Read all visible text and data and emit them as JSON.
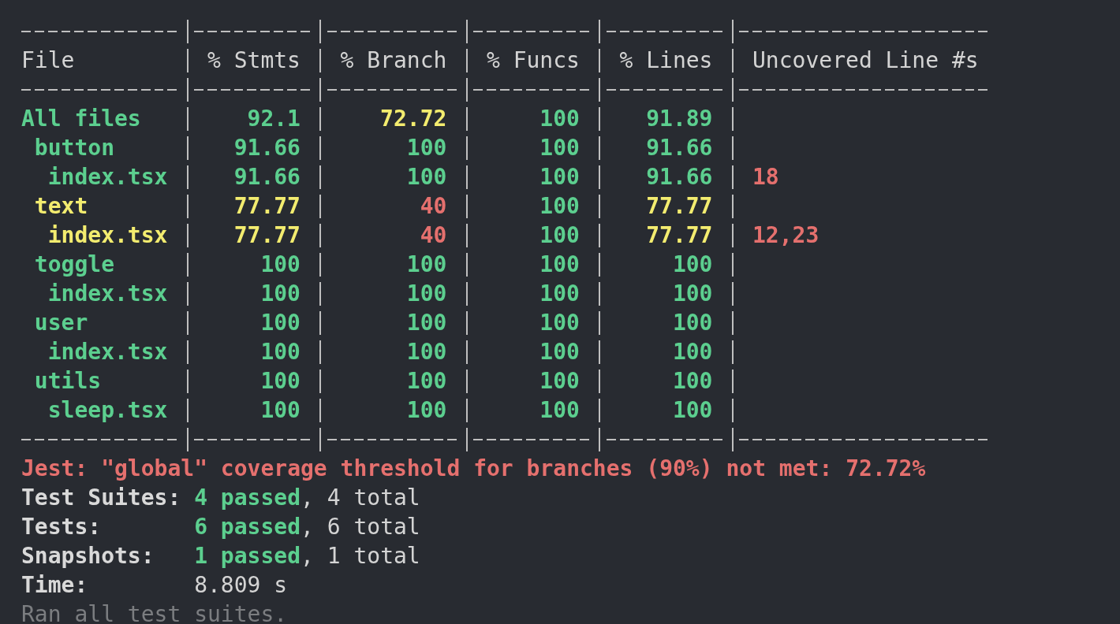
{
  "table": {
    "columns": [
      {
        "kind": "file",
        "label": "File"
      },
      {
        "kind": "stmts",
        "label": "% Stmts"
      },
      {
        "kind": "branch",
        "label": "% Branch"
      },
      {
        "kind": "funcs",
        "label": "% Funcs"
      },
      {
        "kind": "lines",
        "label": "% Lines"
      },
      {
        "kind": "uncovered",
        "label": "Uncovered Line #s"
      }
    ],
    "rows": [
      {
        "file": "All files",
        "color": "#5ccf8f",
        "stmts": {
          "text": "92.1",
          "color": "#5ccf8f"
        },
        "branch": {
          "text": "72.72",
          "color": "#f3ec6f"
        },
        "funcs": {
          "text": "100",
          "color": "#5ccf8f"
        },
        "lines": {
          "text": "91.89",
          "color": "#5ccf8f"
        },
        "children": [
          {
            "file": "button",
            "color": "#5ccf8f",
            "stmts": {
              "text": "91.66",
              "color": "#5ccf8f"
            },
            "branch": {
              "text": "100",
              "color": "#5ccf8f"
            },
            "funcs": {
              "text": "100",
              "color": "#5ccf8f"
            },
            "lines": {
              "text": "91.66",
              "color": "#5ccf8f"
            },
            "children": [
              {
                "file": "index.tsx",
                "color": "#5ccf8f",
                "stmts": {
                  "text": "91.66",
                  "color": "#5ccf8f"
                },
                "branch": {
                  "text": "100",
                  "color": "#5ccf8f"
                },
                "funcs": {
                  "text": "100",
                  "color": "#5ccf8f"
                },
                "lines": {
                  "text": "91.66",
                  "color": "#5ccf8f"
                },
                "uncovered": "18"
              }
            ]
          },
          {
            "file": "text",
            "color": "#f3ec6f",
            "stmts": {
              "text": "77.77",
              "color": "#f3ec6f"
            },
            "branch": {
              "text": "40",
              "color": "#e5706e"
            },
            "funcs": {
              "text": "100",
              "color": "#5ccf8f"
            },
            "lines": {
              "text": "77.77",
              "color": "#f3ec6f"
            },
            "children": [
              {
                "file": "index.tsx",
                "color": "#f3ec6f",
                "stmts": {
                  "text": "77.77",
                  "color": "#f3ec6f"
                },
                "branch": {
                  "text": "40",
                  "color": "#e5706e"
                },
                "funcs": {
                  "text": "100",
                  "color": "#5ccf8f"
                },
                "lines": {
                  "text": "77.77",
                  "color": "#f3ec6f"
                },
                "uncovered": "12,23"
              }
            ]
          },
          {
            "file": "toggle",
            "color": "#5ccf8f",
            "stmts": {
              "text": "100",
              "color": "#5ccf8f"
            },
            "branch": {
              "text": "100",
              "color": "#5ccf8f"
            },
            "funcs": {
              "text": "100",
              "color": "#5ccf8f"
            },
            "lines": {
              "text": "100",
              "color": "#5ccf8f"
            },
            "children": [
              {
                "file": "index.tsx",
                "color": "#5ccf8f",
                "stmts": {
                  "text": "100",
                  "color": "#5ccf8f"
                },
                "branch": {
                  "text": "100",
                  "color": "#5ccf8f"
                },
                "funcs": {
                  "text": "100",
                  "color": "#5ccf8f"
                },
                "lines": {
                  "text": "100",
                  "color": "#5ccf8f"
                }
              }
            ]
          },
          {
            "file": "user",
            "color": "#5ccf8f",
            "stmts": {
              "text": "100",
              "color": "#5ccf8f"
            },
            "branch": {
              "text": "100",
              "color": "#5ccf8f"
            },
            "funcs": {
              "text": "100",
              "color": "#5ccf8f"
            },
            "lines": {
              "text": "100",
              "color": "#5ccf8f"
            },
            "children": [
              {
                "file": "index.tsx",
                "color": "#5ccf8f",
                "stmts": {
                  "text": "100",
                  "color": "#5ccf8f"
                },
                "branch": {
                  "text": "100",
                  "color": "#5ccf8f"
                },
                "funcs": {
                  "text": "100",
                  "color": "#5ccf8f"
                },
                "lines": {
                  "text": "100",
                  "color": "#5ccf8f"
                }
              }
            ]
          },
          {
            "file": "utils",
            "color": "#5ccf8f",
            "stmts": {
              "text": "100",
              "color": "#5ccf8f"
            },
            "branch": {
              "text": "100",
              "color": "#5ccf8f"
            },
            "funcs": {
              "text": "100",
              "color": "#5ccf8f"
            },
            "lines": {
              "text": "100",
              "color": "#5ccf8f"
            },
            "children": [
              {
                "file": "sleep.tsx",
                "color": "#5ccf8f",
                "stmts": {
                  "text": "100",
                  "color": "#5ccf8f"
                },
                "branch": {
                  "text": "100",
                  "color": "#5ccf8f"
                },
                "funcs": {
                  "text": "100",
                  "color": "#5ccf8f"
                },
                "lines": {
                  "text": "100",
                  "color": "#5ccf8f"
                }
              }
            ]
          }
        ]
      }
    ]
  },
  "threshold_message": "Jest: \"global\" coverage threshold for branches (90%) not met: 72.72%",
  "summary": [
    {
      "label": "Test Suites:",
      "passed": "4 passed",
      "total": ", 4 total"
    },
    {
      "label": "Tests:",
      "passed": "6 passed",
      "total": ", 6 total"
    },
    {
      "label": "Snapshots:",
      "passed": "1 passed",
      "total": ", 1 total"
    }
  ],
  "time": {
    "label": "Time:",
    "value": "8.809 s"
  },
  "footer": "Ran all test suites."
}
